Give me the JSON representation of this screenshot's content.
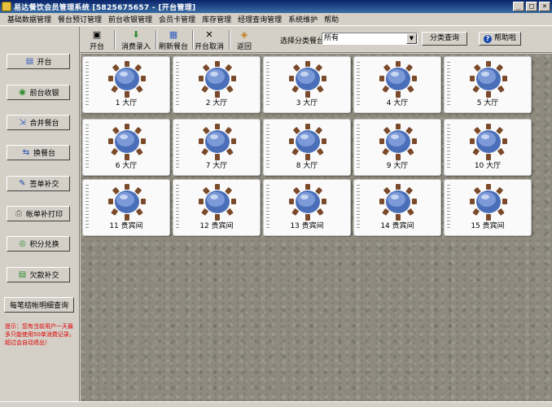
{
  "window": {
    "title": "易达餐饮会员管理系统 [5825675657 - [开台管理]"
  },
  "menu": [
    "基础数据管理",
    "餐台预订管理",
    "前台收银管理",
    "会员卡管理",
    "库存管理",
    "经理查询管理",
    "系统维护",
    "帮助"
  ],
  "toolbar": {
    "buttons": [
      {
        "label": "开台",
        "icon": "open-table-icon"
      },
      {
        "label": "消费录入",
        "icon": "download-icon"
      },
      {
        "label": "刷新餐台",
        "icon": "refresh-icon"
      },
      {
        "label": "开台取消",
        "icon": "close-icon"
      },
      {
        "label": "返回",
        "icon": "return-icon"
      }
    ],
    "filter_label": "选择分类餐台",
    "filter_value": "所有",
    "query_label": "分类查询",
    "help_label": "帮助啦"
  },
  "sidebar": {
    "buttons": [
      {
        "label": "开台"
      },
      {
        "label": "前台收银"
      },
      {
        "label": "合并餐台"
      },
      {
        "label": "换餐台"
      },
      {
        "label": "签单补交"
      },
      {
        "label": "帐单补打印"
      },
      {
        "label": "积分兑换"
      },
      {
        "label": "欠款补交"
      },
      {
        "label": "每笔结帐明细查询"
      }
    ],
    "note": "提示：您有当前用户一天最多只能使用50单消费记录，超过会自动退出！"
  },
  "tables": [
    "1 大厅",
    "2 大厅",
    "3 大厅",
    "4 大厅",
    "5 大厅",
    "6 大厅",
    "7 大厅",
    "8 大厅",
    "9 大厅",
    "10 大厅",
    "11 贵宾间",
    "12 贵宾间",
    "13 贵宾间",
    "14 贵宾间",
    "15 贵宾间"
  ],
  "colors": {
    "title_bar": "#0a246a",
    "note_text": "#e00000",
    "table_top": "#5a7fc8",
    "chair": "#7a4a2a"
  }
}
